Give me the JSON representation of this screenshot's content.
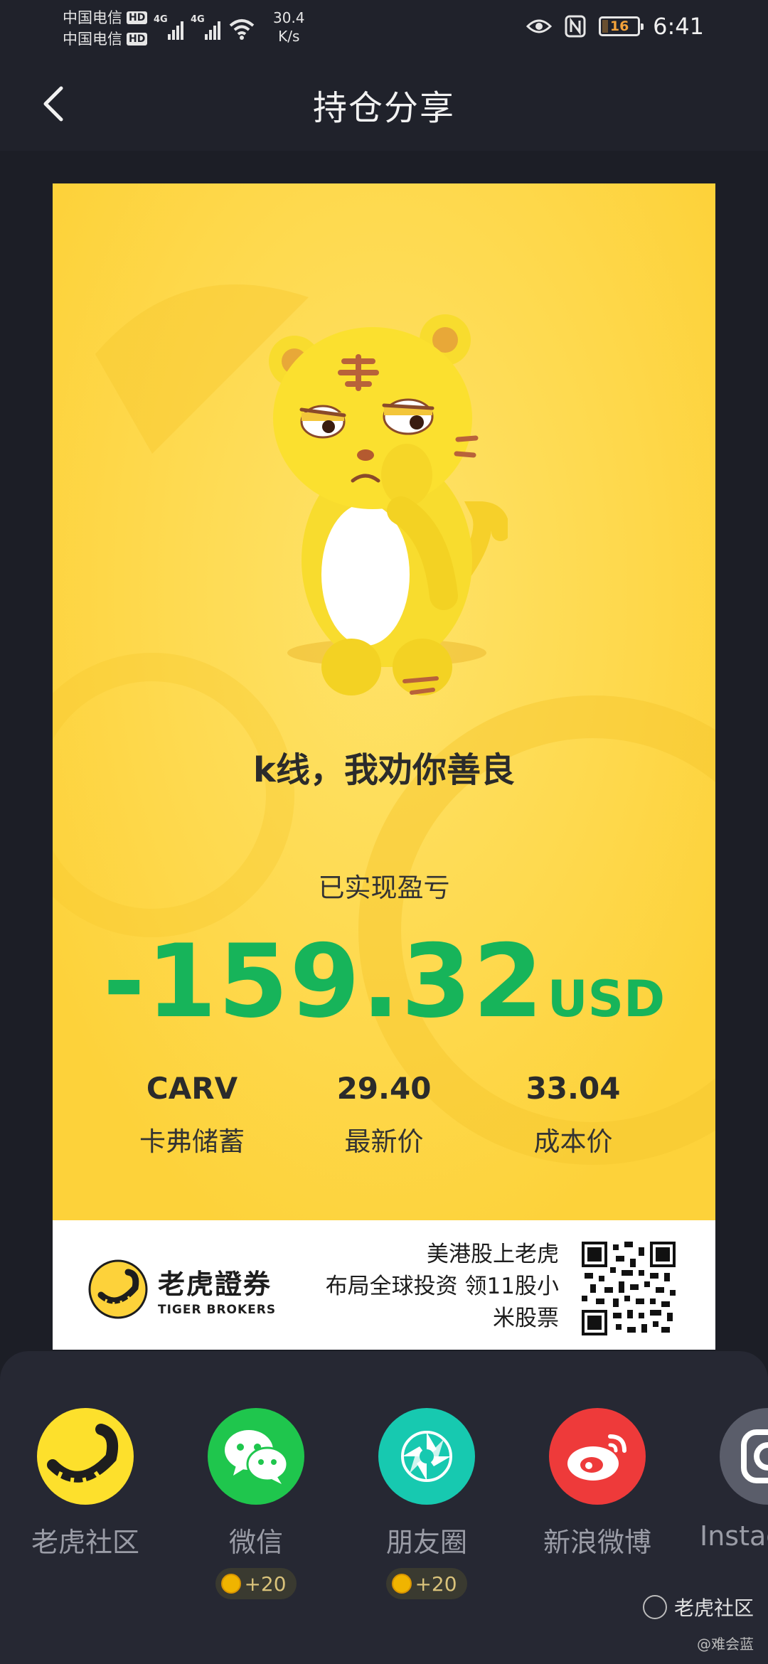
{
  "status_bar": {
    "carrier_1": "中国电信",
    "carrier_2": "中国电信",
    "hd": "HD",
    "network": "4G",
    "net_speed_value": "30.4",
    "net_speed_unit": "K/s",
    "battery_level": "16",
    "time": "6:41",
    "icons": [
      "eye-icon",
      "nfc-icon",
      "battery-icon",
      "wifi-icon",
      "signal-icon"
    ]
  },
  "header": {
    "title": "持仓分享",
    "back_icon": "chevron-left-icon"
  },
  "card": {
    "slogan": "k线，我劝你善良",
    "pnl_label": "已实现盈亏",
    "pnl_value": "-159.32",
    "pnl_currency": "USD",
    "stats": [
      {
        "value": "CARV",
        "label": "卡弗储蓄"
      },
      {
        "value": "29.40",
        "label": "最新价"
      },
      {
        "value": "33.04",
        "label": "成本价"
      }
    ],
    "footer": {
      "brand_cn": "老虎證券",
      "brand_en": "TIGER BROKERS",
      "promo_line_1": "美港股上老虎",
      "promo_line_2": "布局全球投资 领11股小",
      "promo_line_3": "米股票"
    },
    "colors": {
      "background": "#fdd23a",
      "pnl": "#17b45a"
    }
  },
  "share_sheet": {
    "items": [
      {
        "label": "老虎社区",
        "icon": "tiger-community-icon",
        "color": "#1e1e1e",
        "bonus": ""
      },
      {
        "label": "微信",
        "icon": "wechat-icon",
        "color": "#1fc64d",
        "bonus": "+20"
      },
      {
        "label": "朋友圈",
        "icon": "moments-icon",
        "color": "#17c9b0",
        "bonus": "+20"
      },
      {
        "label": "新浪微博",
        "icon": "weibo-icon",
        "color": "#ee3a3a",
        "bonus": ""
      },
      {
        "label": "Instagram",
        "icon": "instagram-icon",
        "color": "#5a5d6a",
        "bonus": ""
      }
    ]
  },
  "watermark": {
    "brand": "老虎社区",
    "author": "@难会蓝"
  }
}
